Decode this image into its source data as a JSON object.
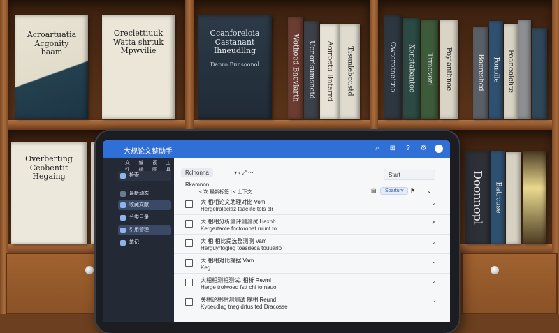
{
  "books": {
    "left_top_1": "Acroartuatia\nAcgonity\nbaam",
    "left_top_2": "Oreclettiuuk\nWatta shrtuk\nMpwvilie",
    "center_top": "Ccanforeloia\nCastanant\nIhneudllng",
    "center_top_sub": "Danro Bunsoonol",
    "spine_1": "Wothoed Bnevlarth",
    "spine_2": "Uenorlsumsnetd",
    "spine_3": "Aoirbetu Bnterrd",
    "spine_4": "Tisunleboustd",
    "spine_5": "Cwtcrotneitno",
    "spine_6": "Xonstabantoc",
    "spine_7": "Trmovorl",
    "spine_8": "Poyiantbnoe",
    "spine_9": "Bocreshcd",
    "spine_10": "Ponolle",
    "spine_11": "Foaneolchte",
    "left_mid": "Overberting\nCeobentit\nHegaing",
    "right_mid_1": "Doonnopl",
    "right_mid_2": "Batrcuse"
  },
  "tablet": {
    "app_title": "大规论文整助手",
    "menu": [
      "文件",
      "编辑",
      "视图",
      "工具"
    ],
    "sidebar_search": "检索",
    "sidebar_label": "最新动态",
    "sidebar_items": [
      "收藏文献",
      "分类目录",
      "引用管理",
      "笔记"
    ],
    "toolbar_tab": "Rclnonna",
    "toolbar_tab2": "Rkamnon",
    "toolbar_sub": "< 次 最新标签 | < 上下文",
    "sort_label": "Start",
    "sort_button": "Soartury",
    "rows": [
      {
        "title": "大 相相论文助理对比 Vom",
        "sub": "Hergelraleclaz tsaelite tols clr"
      },
      {
        "title": "大 相相分析测评测测试 Haxnh",
        "sub": "Kergertaote foctoronet ruunt to"
      },
      {
        "title": "大 相 相比提选整测测 Vam",
        "sub": "Herguyrtogleg toasdeca touuarlo"
      },
      {
        "title": "大 相相对比提据 Vam",
        "sub": "Keg"
      },
      {
        "title": "大相相测相测试. 相析 Rewnl",
        "sub": "Herge trolwoed fstt chi to nauo"
      },
      {
        "title": "关相论相相测测试 提相 Reund",
        "sub": "Kyoecdlag tneg drtus ted Dracosse"
      }
    ]
  }
}
